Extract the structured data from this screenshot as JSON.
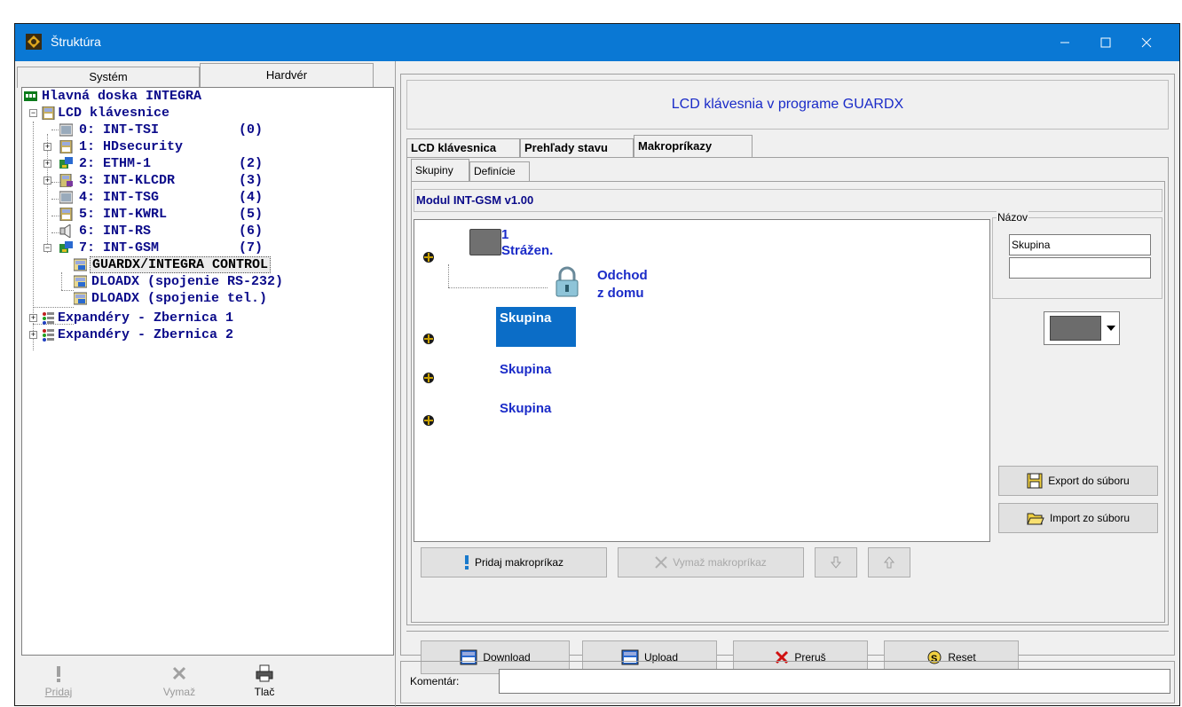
{
  "window": {
    "title": "Štruktúra"
  },
  "left_tabs": [
    "Systém",
    "Hardvér"
  ],
  "tree": {
    "root": "Hlavná doska INTEGRA",
    "lcd": "LCD klávesnice",
    "items": [
      {
        "label": "0: INT-TSI",
        "num": "(0)"
      },
      {
        "label": "1: HDsecurity",
        "num": ""
      },
      {
        "label": "2: ETHM-1",
        "num": "(2)"
      },
      {
        "label": "3: INT-KLCDR",
        "num": "(3)"
      },
      {
        "label": "4: INT-TSG",
        "num": "(4)"
      },
      {
        "label": "5: INT-KWRL",
        "num": "(5)"
      },
      {
        "label": "6: INT-RS",
        "num": "(6)"
      },
      {
        "label": "7: INT-GSM",
        "num": "(7)"
      }
    ],
    "guardx": "GUARDX/INTEGRA CONTROL",
    "dloadx1": "DLOADX (spojenie RS-232)",
    "dloadx2": "DLOADX (spojenie tel.)",
    "exp1": "Expandéry - Zbernica 1",
    "exp2": "Expandéry - Zbernica 2"
  },
  "left_buttons": {
    "add": "Pridaj",
    "delete": "Vymaž",
    "print": "Tlač"
  },
  "header": "LCD klávesnia v programe GUARDX",
  "main_tabs": [
    "LCD klávesnica",
    "Prehľady stavu",
    "Makropríkazy"
  ],
  "sub_tabs": [
    "Skupiny",
    "Definície"
  ],
  "modul": "Modul INT-GSM v1.00",
  "groups": {
    "g1_num": "1",
    "g1_name": "Strážen.",
    "macro_line1": "Odchod",
    "macro_line2": "z domu",
    "skupina": "Skupina"
  },
  "nazov": {
    "legend": "Názov",
    "value": "Skupina",
    "value2": ""
  },
  "buttons": {
    "add_macro": "Pridaj makropríkaz",
    "delete_macro": "Vymaž makropríkaz",
    "export": "Export do súboru",
    "import": "Import zo súboru",
    "download": "Download",
    "upload": "Upload",
    "cancel": "Preruš",
    "reset": "Reset"
  },
  "komentar_label": "Komentár:"
}
